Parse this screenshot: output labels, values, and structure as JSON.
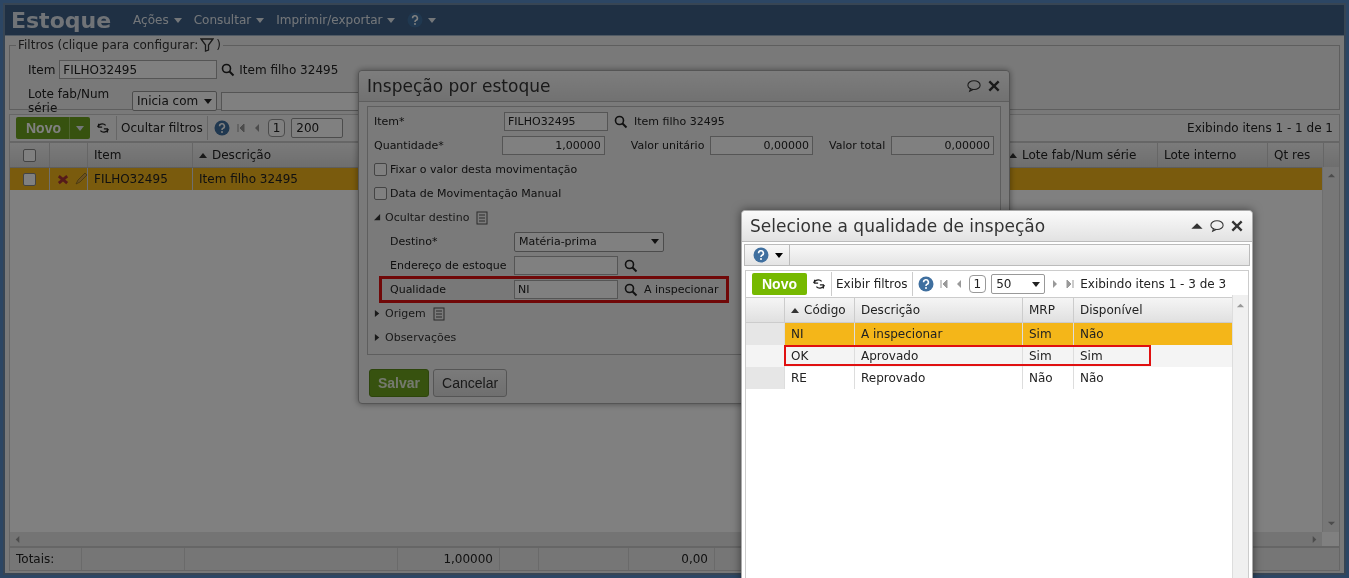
{
  "app": {
    "title": "Estoque",
    "menus": [
      {
        "label": "Ações"
      },
      {
        "label": "Consultar"
      },
      {
        "label": "Imprimir/exportar"
      }
    ]
  },
  "filters": {
    "legend": "Filtros (clique para configurar:",
    "legend_end": ")",
    "item_label": "Item",
    "item_value": "FILHO32495",
    "item_lookup": "Item filho 32495",
    "lote_label": "Lote fab/Num série",
    "lote_mode": "Inicia com"
  },
  "toolbar": {
    "new": "Novo",
    "toggle_filters": "Ocultar filtros",
    "page": "1",
    "page_size": "200",
    "info": "Exibindo itens 1 - 1 de 1"
  },
  "grid": {
    "all_checked": false,
    "columns": [
      {
        "label": "Item",
        "sorted": false
      },
      {
        "label": "Descrição",
        "sorted": true
      },
      {
        "label": "Lote fab/Num série",
        "sorted": true
      },
      {
        "label": "Lote interno",
        "sorted": false
      },
      {
        "label": "Qt res",
        "sorted": false
      }
    ],
    "rows": [
      {
        "selected": true,
        "checked": false,
        "cells": [
          "FILHO32495",
          "Item filho 32495"
        ]
      }
    ],
    "totals": {
      "label": "Totais:",
      "quantity": "1,00000",
      "value": "0,00"
    }
  },
  "inspection_dialog": {
    "title": "Inspeção por estoque",
    "item_label": "Item*",
    "item_value": "FILHO32495",
    "item_lookup": "Item filho 32495",
    "qty_label": "Quantidade*",
    "qty_value": "1,00000",
    "unit_label": "Valor unitário",
    "unit_value": "0,00000",
    "total_label": "Valor total",
    "total_value": "0,00000",
    "checkboxes": [
      {
        "label": "Fixar o valor desta movimentação",
        "checked": false
      },
      {
        "label": "Data de Movimentação Manual",
        "checked": false
      }
    ],
    "sections": [
      {
        "label": "Ocultar destino",
        "expanded": true,
        "note": true,
        "fields": [
          {
            "kind": "select",
            "label": "Destino*",
            "value": "Matéria-prima",
            "highlighted": false
          },
          {
            "kind": "lookup",
            "label": "Endereço de estoque",
            "highlighted": false
          },
          {
            "kind": "lookup",
            "label": "Qualidade",
            "value": "NI",
            "lookup": "A inspecionar",
            "highlighted": true
          }
        ]
      },
      {
        "label": "Origem",
        "expanded": false,
        "note": true
      },
      {
        "label": "Observações",
        "expanded": false,
        "note": false
      }
    ],
    "buttons": [
      {
        "label": "Salvar",
        "kind": "primary"
      },
      {
        "label": "Cancelar",
        "kind": "secondary"
      }
    ]
  },
  "quality_dialog": {
    "title": "Selecione a qualidade de inspeção",
    "toolbar": {
      "new": "Novo",
      "toggle_filters": "Exibir filtros",
      "page": "1",
      "page_size": "50",
      "info": "Exibindo itens 1 - 3 de 3"
    },
    "columns": [
      {
        "label": "Código",
        "sorted": true
      },
      {
        "label": "Descrição",
        "sorted": false
      },
      {
        "label": "MRP",
        "sorted": false
      },
      {
        "label": "Disponível",
        "sorted": false
      }
    ],
    "rows": [
      {
        "selected": true,
        "highlighted": false,
        "cells": [
          "NI",
          "A inspecionar",
          "Sim",
          "Não"
        ]
      },
      {
        "selected": false,
        "highlighted": true,
        "cells": [
          "OK",
          "Aprovado",
          "Sim",
          "Sim"
        ]
      },
      {
        "selected": false,
        "highlighted": false,
        "cells": [
          "RE",
          "Reprovado",
          "Não",
          "Não"
        ]
      }
    ]
  }
}
